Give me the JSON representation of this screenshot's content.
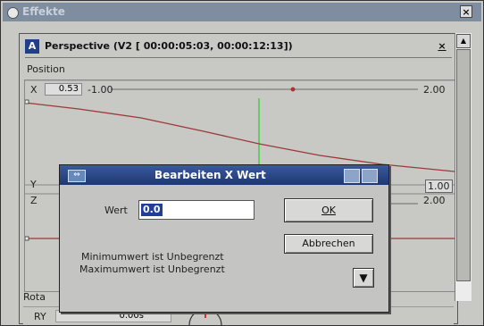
{
  "window": {
    "title": "Effekte"
  },
  "panel": {
    "title": "Perspective (V2 [ 00:00:05:03,  00:00:12:13])",
    "section_position": "Position",
    "section_rotation": "Rota",
    "x": {
      "label": "X",
      "value": "0.53",
      "min": "-1.00",
      "max": "2.00"
    },
    "y": {
      "label": "Y",
      "max": "1.00"
    },
    "z": {
      "label": "Z",
      "max": "2.00"
    },
    "ry": {
      "label": "RY",
      "value": "0.00s"
    }
  },
  "dialog": {
    "title": "Bearbeiten X Wert",
    "field_label": "Wert",
    "field_value": "0.0",
    "ok_label": "OK",
    "cancel_label": "Abbrechen",
    "min_text": "Minimumwert ist  Unbegrenzt",
    "max_text": "Maximumwert ist  Unbegrenzt"
  },
  "colors": {
    "curve": "#9a3a3a",
    "cursor": "#3fcf3f",
    "accent": "#1f3f9a"
  }
}
